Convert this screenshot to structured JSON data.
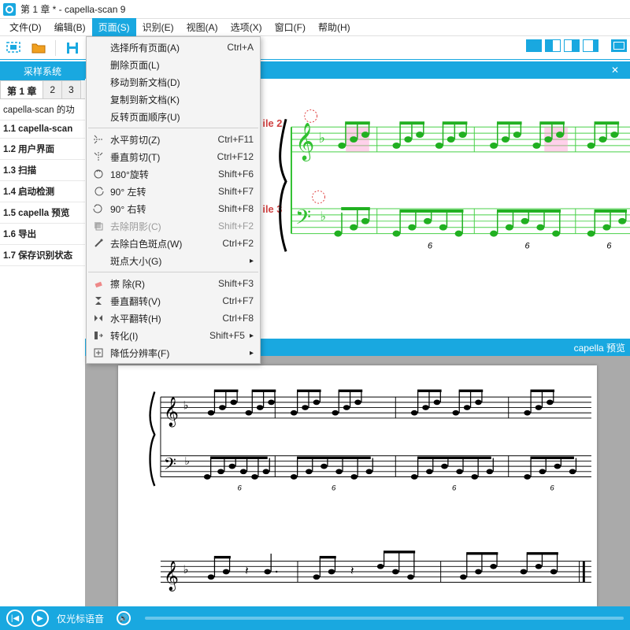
{
  "title": "第 1 章 * - capella-scan 9",
  "menubar": [
    "文件(D)",
    "编辑(B)",
    "页面(S)",
    "识别(E)",
    "视图(A)",
    "选项(X)",
    "窗口(F)",
    "帮助(H)"
  ],
  "menubar_open_index": 2,
  "sampling_header": "采样系统",
  "tabs": [
    "第 1 章",
    "2",
    "3"
  ],
  "tree": [
    {
      "label": "capella-scan 的功",
      "bold": false
    },
    {
      "label": "1.1 capella-scan",
      "bold": true
    },
    {
      "label": "1.2 用户界面",
      "bold": true
    },
    {
      "label": "1.3 扫描",
      "bold": true
    },
    {
      "label": "1.4 启动检测",
      "bold": true
    },
    {
      "label": "1.5 capella 预览",
      "bold": true
    },
    {
      "label": "1.6 导出",
      "bold": true
    },
    {
      "label": "1.7 保存识别状态",
      "bold": true
    }
  ],
  "dropdown": [
    {
      "type": "item",
      "label": "选择所有页面(A)",
      "shortcut": "Ctrl+A"
    },
    {
      "type": "item",
      "label": "删除页面(L)"
    },
    {
      "type": "item",
      "label": "移动到新文档(D)"
    },
    {
      "type": "item",
      "label": "复制到新文档(K)"
    },
    {
      "type": "item",
      "label": "反转页面顺序(U)"
    },
    {
      "type": "sep"
    },
    {
      "type": "item",
      "icon": "hcut",
      "label": "水平剪切(Z)",
      "shortcut": "Ctrl+F11"
    },
    {
      "type": "item",
      "icon": "vcut",
      "label": "垂直剪切(T)",
      "shortcut": "Ctrl+F12"
    },
    {
      "type": "item",
      "icon": "rot180",
      "label": "180°旋转",
      "shortcut": "Shift+F6"
    },
    {
      "type": "item",
      "icon": "rotl",
      "label": "90° 左转",
      "shortcut": "Shift+F7"
    },
    {
      "type": "item",
      "icon": "rotr",
      "label": "90° 右转",
      "shortcut": "Shift+F8"
    },
    {
      "type": "item",
      "icon": "shadow",
      "label": "去除阴影(C)",
      "shortcut": "Shift+F2",
      "disabled": true
    },
    {
      "type": "item",
      "icon": "wand",
      "label": "去除白色斑点(W)",
      "shortcut": "Ctrl+F2"
    },
    {
      "type": "sub",
      "label": "斑点大小(G)"
    },
    {
      "type": "sep"
    },
    {
      "type": "item",
      "icon": "eraser",
      "label": "擦 除(R)",
      "shortcut": "Shift+F3"
    },
    {
      "type": "item",
      "icon": "flipv",
      "label": "垂直翻转(V)",
      "shortcut": "Ctrl+F7"
    },
    {
      "type": "item",
      "icon": "fliph",
      "label": "水平翻转(H)",
      "shortcut": "Ctrl+F8"
    },
    {
      "type": "sub",
      "icon": "conv",
      "label": "转化(I)",
      "shortcut": "Shift+F5"
    },
    {
      "type": "sub",
      "icon": "lowres",
      "label": "降低分辨率(F)"
    }
  ],
  "doc_labels": {
    "ile2": "ile 2",
    "ile3": "ile 3"
  },
  "preview_header": "capella 预览",
  "playbar_text": "仅光标语音",
  "tuplet_number": "6"
}
